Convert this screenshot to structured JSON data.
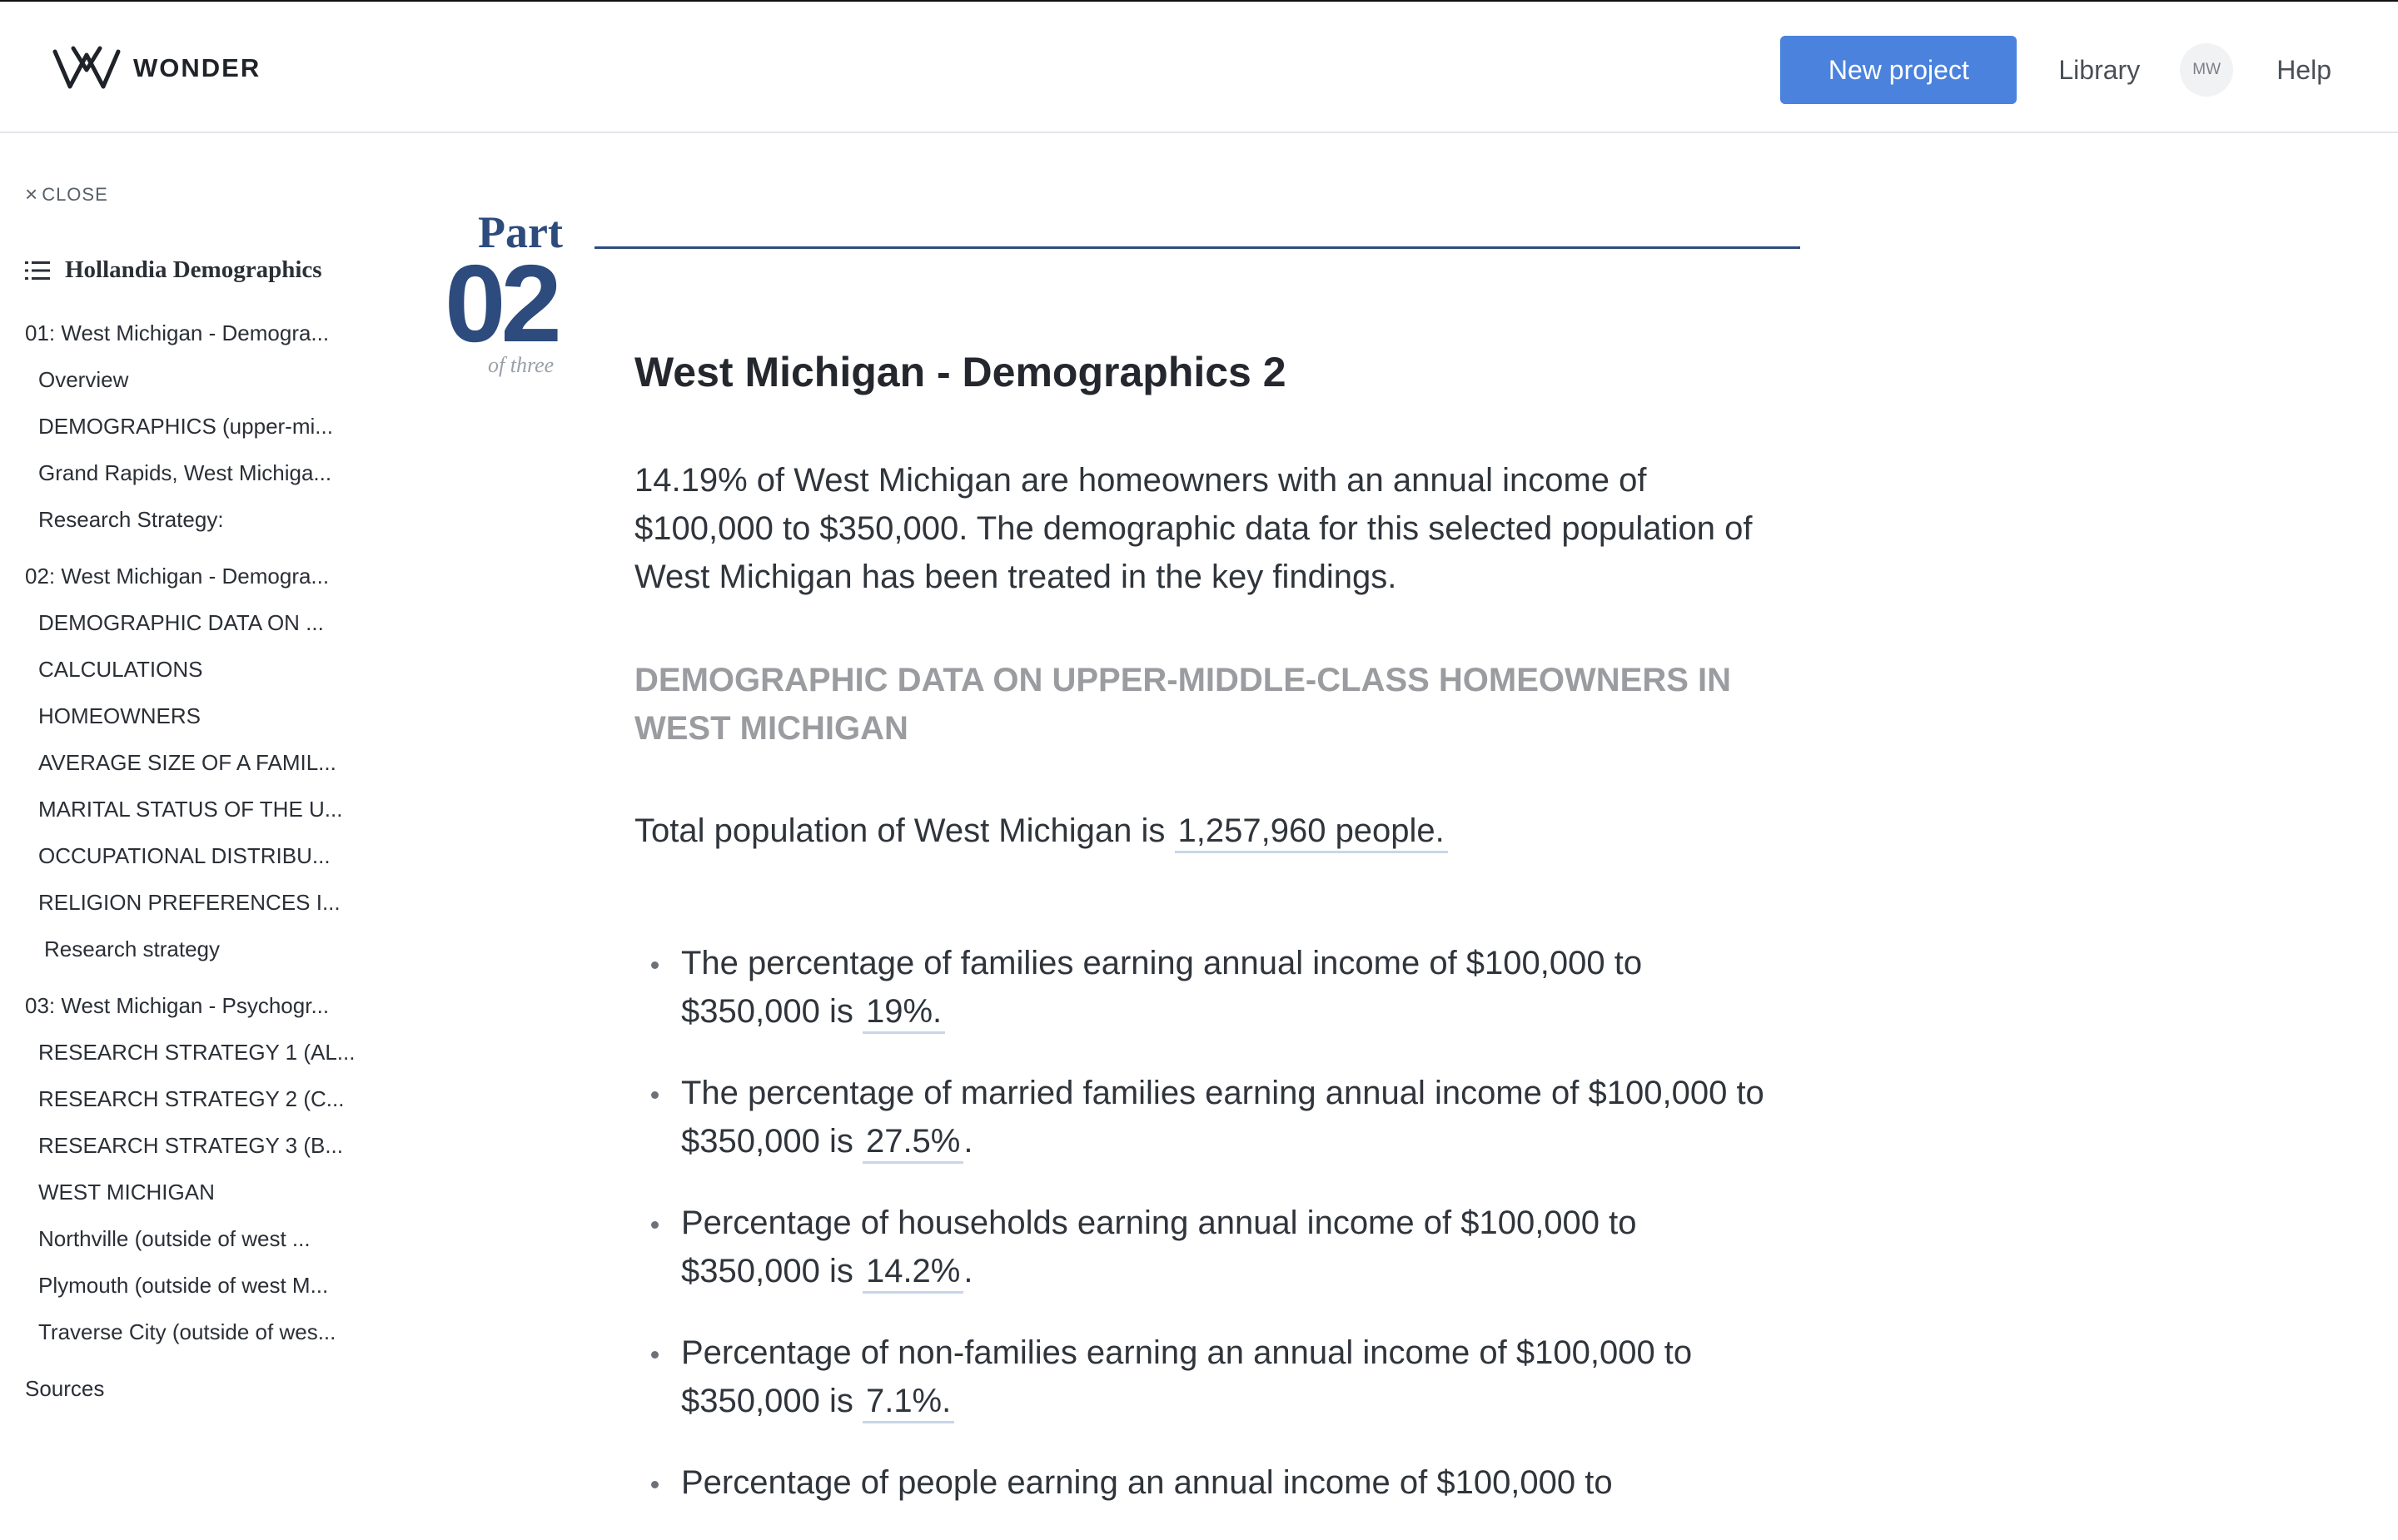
{
  "header": {
    "brand": "WONDER",
    "new_project_label": "New project",
    "library_label": "Library",
    "avatar_initials": "MW",
    "help_label": "Help"
  },
  "sidebar": {
    "close_label": "CLOSE",
    "title": "Hollandia Demographics",
    "items": [
      {
        "label": "01: West Michigan - Demogra...",
        "level": 0
      },
      {
        "label": "Overview",
        "level": 1
      },
      {
        "label": "DEMOGRAPHICS (upper-mi...",
        "level": 1
      },
      {
        "label": "Grand Rapids, West Michiga...",
        "level": 1
      },
      {
        "label": "Research Strategy:",
        "level": 1
      },
      {
        "label": "02: West Michigan - Demogra...",
        "level": 0
      },
      {
        "label": "DEMOGRAPHIC DATA ON ...",
        "level": 1
      },
      {
        "label": "CALCULATIONS",
        "level": 1
      },
      {
        "label": "HOMEOWNERS",
        "level": 1
      },
      {
        "label": "AVERAGE SIZE OF A FAMIL...",
        "level": 1
      },
      {
        "label": "MARITAL STATUS OF THE U...",
        "level": 1
      },
      {
        "label": "OCCUPATIONAL DISTRIBU...",
        "level": 1
      },
      {
        "label": "RELIGION PREFERENCES I...",
        "level": 1
      },
      {
        "label": "Research strategy",
        "level": 2
      },
      {
        "label": "03: West Michigan - Psychogr...",
        "level": 0
      },
      {
        "label": "RESEARCH STRATEGY 1 (AL...",
        "level": 1
      },
      {
        "label": "RESEARCH STRATEGY 2 (C...",
        "level": 1
      },
      {
        "label": "RESEARCH STRATEGY 3 (B...",
        "level": 1
      },
      {
        "label": "WEST MICHIGAN",
        "level": 1
      },
      {
        "label": "Northville (outside of west ...",
        "level": 1
      },
      {
        "label": "Plymouth (outside of west M...",
        "level": 1
      },
      {
        "label": "Traverse City (outside of wes...",
        "level": 1
      },
      {
        "label": "Sources",
        "level": 0
      }
    ]
  },
  "main": {
    "part_label": "Part",
    "part_number": "02",
    "part_of": "of three",
    "title": "West Michigan - Demographics 2",
    "intro": "14.19% of West Michigan are homeowners with an annual income of $100,000 to $350,000. The demographic data for this selected population of West Michigan has been treated in the key findings.",
    "section_heading": "DEMOGRAPHIC DATA ON UPPER-MIDDLE-CLASS HOMEOWNERS IN WEST MICHIGAN",
    "total_prefix": "Total population of West Michigan is ",
    "total_value": "1,257,960 people.",
    "bullets": [
      {
        "text": "The percentage of families earning annual income of $100,000 to $350,000 is ",
        "value": "19%.",
        "suffix": ""
      },
      {
        "text": "The percentage of married families earning annual income of $100,000 to $350,000 is ",
        "value": "27.5%",
        "suffix": "."
      },
      {
        "text": "Percentage of households earning annual income of $100,000 to $350,000 is ",
        "value": "14.2%",
        "suffix": "."
      },
      {
        "text": "Percentage of non-families earning an annual income of $100,000 to $350,000 is ",
        "value": "7.1%.",
        "suffix": ""
      },
      {
        "text": "Percentage of people earning an annual income of $100,000 to",
        "value": "",
        "suffix": ""
      }
    ]
  },
  "colors": {
    "accent": "#4a82dd",
    "part_navy": "#2d4b7d",
    "section_heading_gray": "#9a9ca0"
  }
}
